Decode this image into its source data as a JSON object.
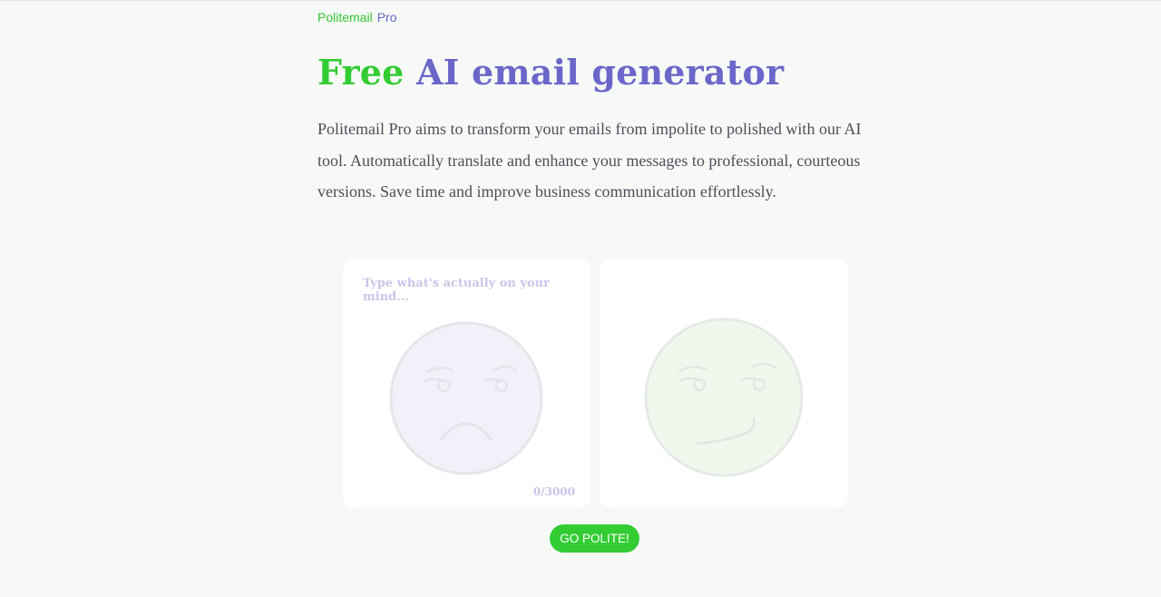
{
  "header": {
    "brand_part1": "Politemail",
    "brand_part2": "Pro"
  },
  "hero": {
    "title_part1": "Free",
    "title_part2": "AI email generator",
    "description": "Politemail Pro aims to transform your emails from impolite to polished with our AI tool. Automatically translate and enhance your messages to professional, courteous versions. Save time and improve business communication effortlessly."
  },
  "input_card": {
    "placeholder": "Type what's actually on your mind...",
    "value": "",
    "char_count": "0/3000",
    "face_icon": "sad-face-icon"
  },
  "output_card": {
    "value": "",
    "face_icon": "smirk-face-icon"
  },
  "actions": {
    "go_label": "GO POLITE!"
  },
  "colors": {
    "background": "#f7f9f7",
    "brand_green": "#33cc33",
    "brand_purple": "#6a67c9",
    "body_text": "#4c4f5b",
    "placeholder": "#c9c6ea"
  }
}
